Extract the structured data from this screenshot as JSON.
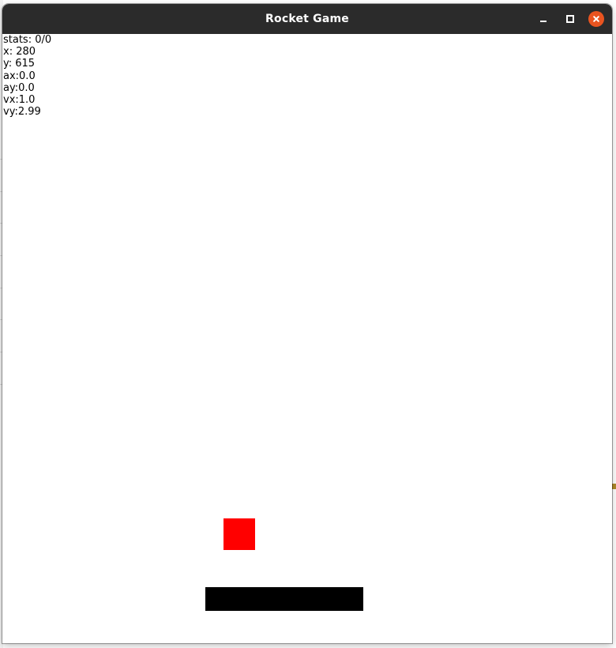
{
  "window": {
    "title": "Rocket Game"
  },
  "hud": {
    "stats": "stats: 0/0",
    "x": "x: 280",
    "y": "y: 615",
    "ax": "ax:0.0",
    "ay": "ay:0.0",
    "vx": "vx:1.0",
    "vy": "vy:2.99"
  },
  "colors": {
    "titlebar": "#2b2b2b",
    "close_button": "#e95420",
    "rocket": "#ff0000",
    "platform": "#000000",
    "canvas_background": "#ffffff"
  },
  "icons": {
    "minimize": "minimize-icon",
    "maximize": "maximize-icon",
    "close": "close-icon"
  }
}
